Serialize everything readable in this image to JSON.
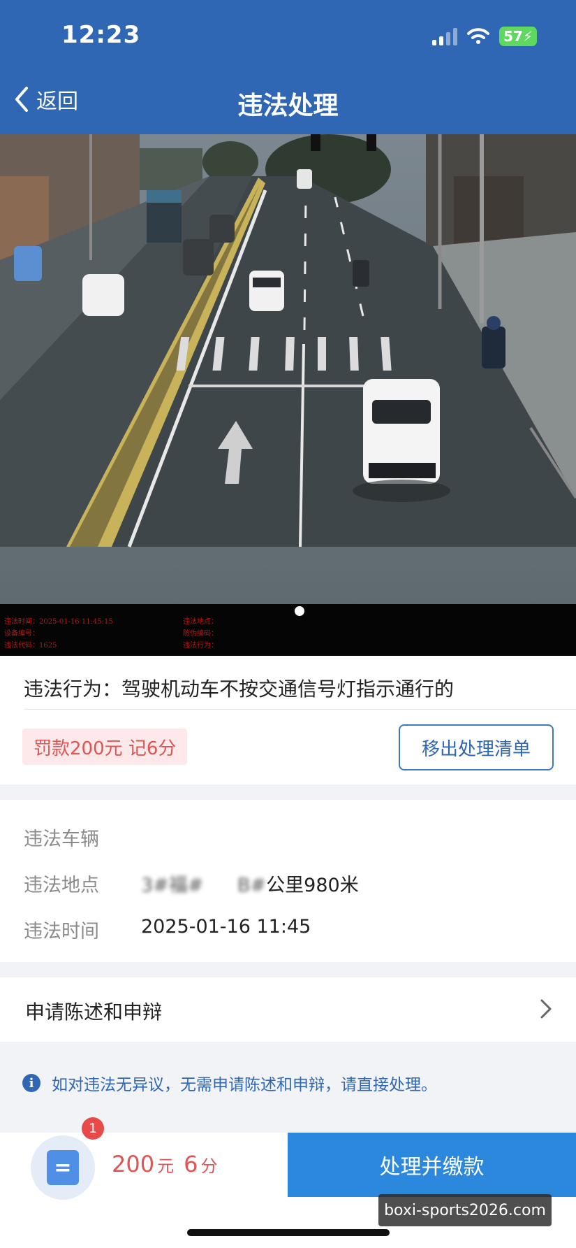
{
  "status_bar": {
    "time": "12:23",
    "battery": "57",
    "icons": [
      "signal-icon",
      "wifi-icon",
      "battery-charging-icon"
    ]
  },
  "nav": {
    "back_label": "返回",
    "title": "违法处理"
  },
  "photo": {
    "info_left": [
      "违法时间：2025-01-16 11:45:15",
      "设备编号：",
      "违法代码：1625"
    ],
    "info_right": [
      "违法地点：",
      "防伪编码：",
      "违法行为："
    ]
  },
  "violation": {
    "behavior": "违法行为：驾驶机动车不按交通信号灯指示通行的",
    "fine_text": "罚款200元  记6分",
    "remove_button": "移出处理清单"
  },
  "details": {
    "vehicle_label": "违法车辆",
    "vehicle_value": "",
    "location_label": "违法地点",
    "location_blurred": "3#福#",
    "location_blurred_2": "B#",
    "location_value": "公里980米",
    "time_label": "违法时间",
    "time_value": "2025-01-16 11:45"
  },
  "appeal": {
    "label": "申请陈述和申辩"
  },
  "notice": {
    "text": "如对违法无异议，无需申请陈述和申辩，请直接处理。"
  },
  "bottom": {
    "badge_count": "1",
    "list_icon_glyph": "=",
    "fine_amount": "200",
    "fine_unit": "元",
    "points_amount": "6",
    "points_unit": "分",
    "pay_button": "处理并缴款"
  },
  "watermark": "boxi-sports2026.com",
  "colors": {
    "header": "#2f67b5",
    "accent_blue": "#2b88dc",
    "fine_red": "#e05454",
    "badge_red": "#e84a4a"
  }
}
